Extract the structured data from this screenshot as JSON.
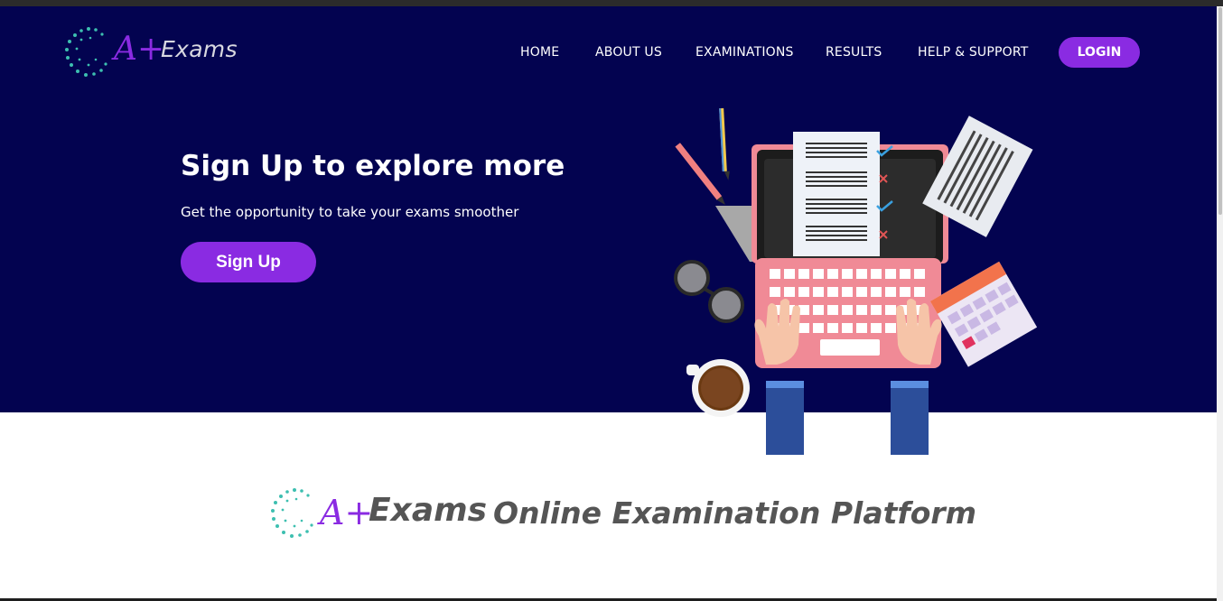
{
  "header": {
    "brand_mark": "A+",
    "brand_name": "Exams",
    "nav": [
      "HOME",
      "ABOUT US",
      "EXAMINATIONS",
      "RESULTS",
      "HELP & SUPPORT"
    ],
    "login_label": "LOGIN"
  },
  "hero": {
    "title": "Sign Up to explore more",
    "subtitle": "Get the opportunity to take your exams smoother",
    "signup_label": "Sign Up"
  },
  "section": {
    "brand_mark": "A+",
    "brand_name": "Exams",
    "tagline": "Online Examination Platform"
  },
  "colors": {
    "hero_bg": "#030350",
    "accent_purple": "#8a2be2",
    "teal_dots": "#3dbfb0",
    "laptop_pink": "#f08a96"
  },
  "icons": [
    "logo-dots-icon",
    "pencil-icon",
    "glasses-icon",
    "coffee-cup-icon",
    "calendar-icon",
    "checkmark-icon",
    "cross-icon"
  ]
}
